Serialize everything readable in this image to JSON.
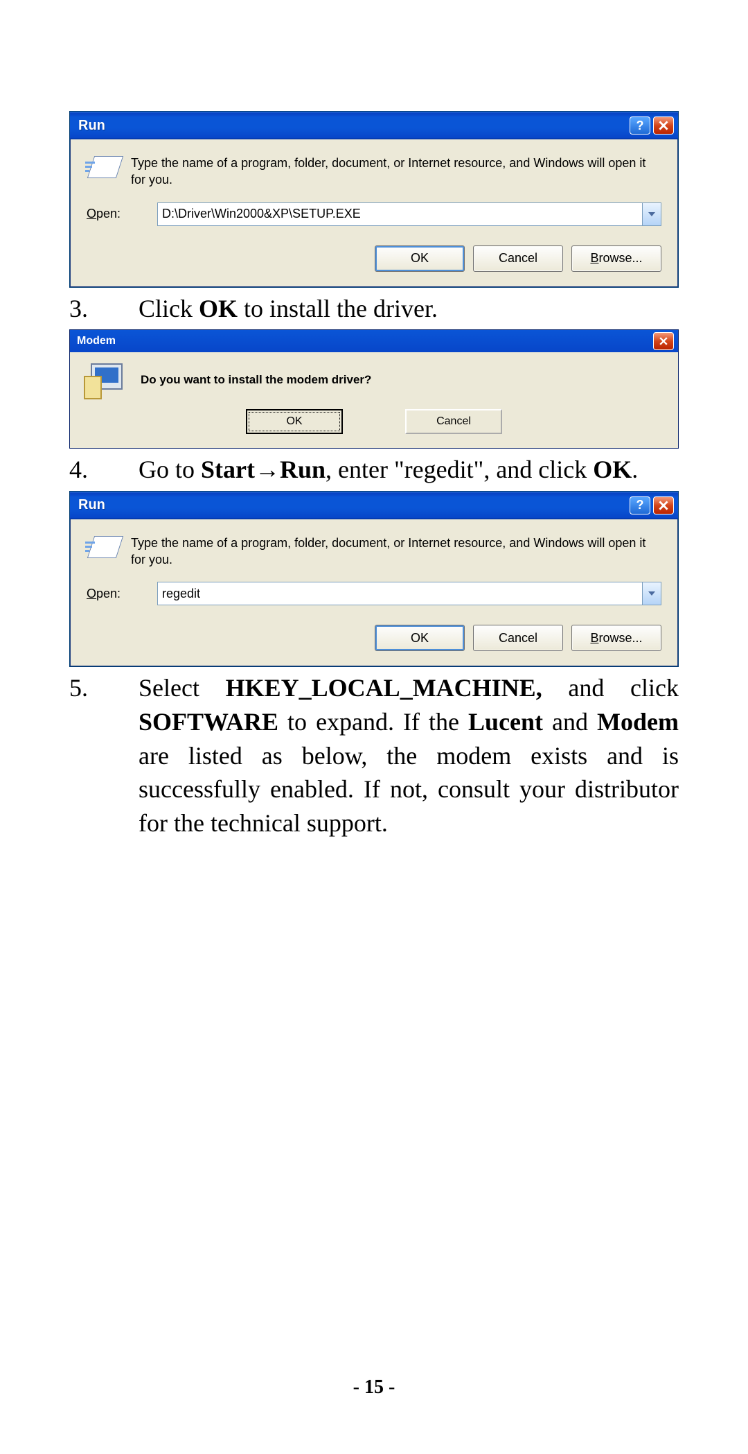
{
  "run1": {
    "title": "Run",
    "desc": "Type the name of a program, folder, document, or Internet resource, and Windows will open it for you.",
    "open_label_pre": "O",
    "open_label_rest": "pen:",
    "value": "D:\\Driver\\Win2000&XP\\SETUP.EXE",
    "ok": "OK",
    "cancel": "Cancel",
    "browse_pre": "B",
    "browse_rest": "rowse..."
  },
  "step3": {
    "num": "3.",
    "pre": "Click ",
    "bold": "OK",
    "post": " to install the driver."
  },
  "modem": {
    "title": "Modem",
    "question": "Do you want to install the modem driver?",
    "ok_pre": "O",
    "ok_rest": "K",
    "cancel_pre": "C",
    "cancel_rest": "ancel"
  },
  "step4": {
    "num": "4.",
    "p1": "Go to ",
    "b1": "Start",
    "arrow": "→",
    "b2": "Run",
    "p2": ", enter \"regedit\", and click ",
    "b3": "OK",
    "p3": "."
  },
  "run2": {
    "title": "Run",
    "desc": "Type the name of a program, folder, document, or Internet resource, and Windows will open it for you.",
    "open_label_pre": "O",
    "open_label_rest": "pen:",
    "value": "regedit",
    "ok": "OK",
    "cancel": "Cancel",
    "browse_pre": "B",
    "browse_rest": "rowse..."
  },
  "step5": {
    "num": "5.",
    "p1": "Select ",
    "b1": "HKEY_LOCAL_MACHINE,",
    "p2": " and click ",
    "b2": "SOFTWARE",
    "p3": " to expand.  If the ",
    "b3": "Lucent",
    "p4": " and ",
    "b4": "Modem",
    "p5": " are listed as below, the modem exists and is successfully enabled.  If not, consult your distributor for the technical support."
  },
  "pagenum": "15"
}
